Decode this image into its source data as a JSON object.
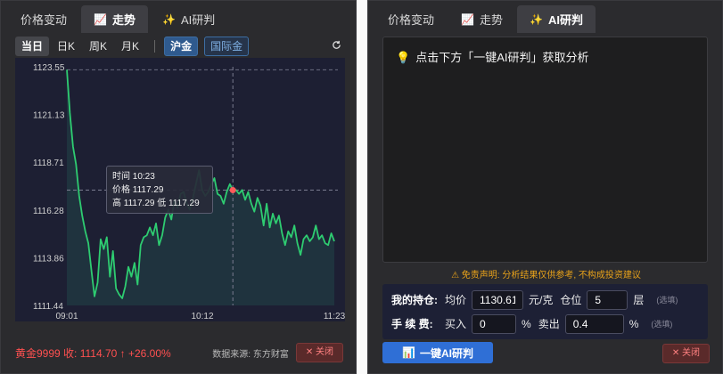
{
  "left": {
    "tabs": [
      {
        "label": "价格变动",
        "icon": ""
      },
      {
        "label": "走势",
        "icon": "📈"
      },
      {
        "label": "AI研判",
        "icon": "✨"
      }
    ],
    "periods": [
      "当日",
      "日K",
      "周K",
      "月K"
    ],
    "markets": [
      "沪金",
      "国际金"
    ],
    "tooltip": {
      "time": "时间 10:23",
      "price": "价格 1117.29",
      "range": "高 1117.29  低 1117.29"
    },
    "footer": {
      "price_line": "黄金9999  收: 1114.70 ↑ +26.00%",
      "source": "数据来源: 东方财富",
      "close": "✕ 关闭"
    }
  },
  "right": {
    "tabs": [
      {
        "label": "价格变动",
        "icon": ""
      },
      {
        "label": "走势",
        "icon": "📈"
      },
      {
        "label": "AI研判",
        "icon": "✨"
      }
    ],
    "prompt": "点击下方「一键AI研判」获取分析",
    "disclaimer": "⚠ 免责声明: 分析结果仅供参考, 不构成投资建议",
    "holding": {
      "label": "我的持仓:",
      "avg_label": "均价",
      "avg_value": "1130.61",
      "avg_unit": "元/克",
      "pos_label": "仓位",
      "pos_value": "5",
      "pos_unit": "层",
      "optional": "(选填)"
    },
    "fees": {
      "label": "手 续 费:",
      "buy_label": "买入",
      "buy_value": "0",
      "sell_label": "卖出",
      "sell_value": "0.4",
      "unit": "%",
      "optional": "(选填)"
    },
    "ai_button": "一键AI研判",
    "close": "✕ 关闭"
  },
  "chart_data": {
    "type": "line",
    "y_ticks": [
      "1123.55",
      "1121.13",
      "1118.71",
      "1116.28",
      "1113.86",
      "1111.44"
    ],
    "x_ticks": [
      "09:01",
      "10:12",
      "11:23"
    ],
    "ylim": [
      1111.44,
      1123.55
    ],
    "x_start": "09:01",
    "x_end": "11:23",
    "highlight": {
      "x": "10:23",
      "y": 1117.29
    },
    "series": [
      {
        "values": [
          1123.4,
          1121.2,
          1119.5,
          1118.6,
          1117.0,
          1116.0,
          1115.2,
          1114.6,
          1113.2,
          1111.9,
          1112.6,
          1114.8,
          1114.3,
          1114.9,
          1112.9,
          1114.2,
          1112.3,
          1112.0,
          1111.8,
          1112.4,
          1113.4,
          1112.9,
          1113.6,
          1112.5,
          1114.5,
          1114.9,
          1115.0,
          1115.4,
          1115.0,
          1115.6,
          1114.5,
          1115.0,
          1115.9,
          1116.3,
          1115.8,
          1116.8,
          1116.4,
          1117.1,
          1117.2,
          1116.6,
          1116.3,
          1116.9,
          1117.6,
          1118.3,
          1117.3,
          1117.0,
          1117.2,
          1117.6,
          1117.9,
          1117.1,
          1117.0,
          1116.6,
          1117.2,
          1117.6,
          1117.29,
          1117.3,
          1117.1,
          1117.3,
          1116.8,
          1117.2,
          1116.6,
          1116.2,
          1116.9,
          1116.5,
          1115.5,
          1116.6,
          1115.4,
          1116.1,
          1115.6,
          1116.0,
          1115.1,
          1114.5,
          1115.2,
          1114.9,
          1115.5,
          1114.6,
          1114.0,
          1114.8,
          1115.0,
          1114.7,
          1114.9,
          1115.5,
          1114.8,
          1115.0,
          1114.6,
          1114.5,
          1115.1,
          1114.7
        ]
      }
    ],
    "grid": false
  }
}
